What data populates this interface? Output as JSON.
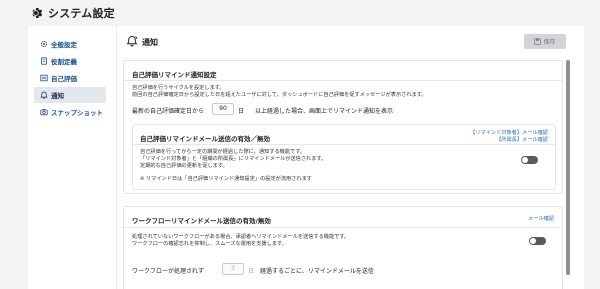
{
  "app": {
    "title": "システム設定"
  },
  "sidebar": {
    "items": [
      {
        "label": "全般設定",
        "icon": "gear-icon"
      },
      {
        "label": "役割定義",
        "icon": "document-icon"
      },
      {
        "label": "自己評価",
        "icon": "list-icon"
      },
      {
        "label": "通知",
        "icon": "bell-icon",
        "active": true
      },
      {
        "label": "スナップショット",
        "icon": "camera-icon"
      }
    ]
  },
  "main": {
    "title": "通知",
    "save_label": "保存"
  },
  "self_eval_reminder": {
    "title": "自己評価リマインド通知設定",
    "desc_line1": "自己評価を行うサイクルを設定します。",
    "desc_line2": "前回の自己評価確定日から設定した日を超えたユーザに対して、ダッシュボードに自己評価を促すメッセージが表示されます。",
    "row_prefix": "最新の自己評価確定日から",
    "days_value": "90",
    "days_unit": "日",
    "row_suffix": "以上経過した場合、画面上でリマインド通知を表示",
    "mail": {
      "title": "自己評価リマインドメール送信の有効／無効",
      "link_target": "【リマインド対象者】メール確認",
      "link_dept": "【所属長】メール確認",
      "desc_line1": "自己評価を行ってから一定の期間が経過した際に、通知する機能です。",
      "desc_line2": "「リマインド対象者」と「組織の所属長」にリマインドメールが送信されます。",
      "desc_line3": "定期的な自己評価の更新を促します。",
      "note": "※ リマインド日は「自己評価リマインド通知設定」の設定が流用されます",
      "enabled": false
    }
  },
  "workflow_reminder": {
    "title": "ワークフローリマインドメール送信の有効/無効",
    "link": "メール確認",
    "desc_line1": "処理されていないワークフローがある場合、承認者へリマインドメールを送信する機能です。",
    "desc_line2": "ワークフローの確認忘れを抑制し、スムーズな運用を支援します。",
    "row_prefix": "ワークフローが処理されず",
    "days_value": "3",
    "days_unit": "日",
    "row_suffix": "経過するごとに、リマインドメールを送信",
    "enabled": false
  },
  "colors": {
    "accent": "#1f4e8c",
    "link": "#2f6fc9",
    "toggle_off": "#5a5a5a"
  }
}
